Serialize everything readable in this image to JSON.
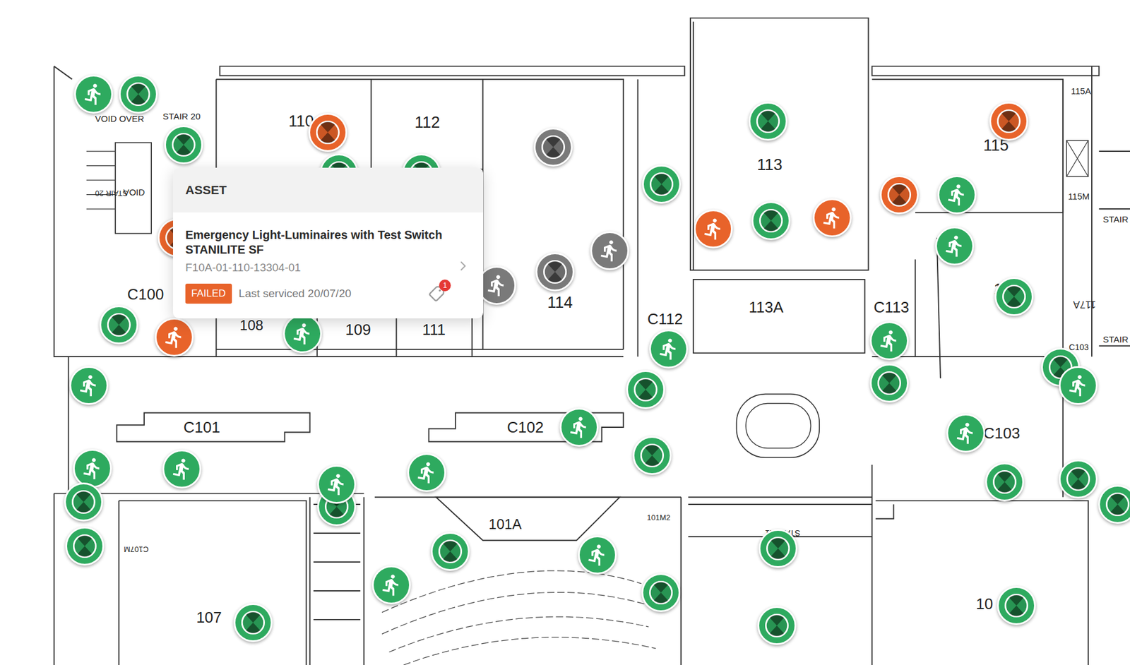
{
  "rooms": [
    {
      "label": "110"
    },
    {
      "label": "112"
    },
    {
      "label": "113"
    },
    {
      "label": "114"
    },
    {
      "label": "115"
    },
    {
      "label": "115A"
    },
    {
      "label": "115M"
    },
    {
      "label": "STAIR 20"
    },
    {
      "label": "VOID OVER"
    },
    {
      "label": "VOID"
    },
    {
      "label": "STAIR 20"
    },
    {
      "label": "C100"
    },
    {
      "label": "108"
    },
    {
      "label": "109"
    },
    {
      "label": "111"
    },
    {
      "label": "C112"
    },
    {
      "label": "113A"
    },
    {
      "label": "C113"
    },
    {
      "label": "11"
    },
    {
      "label": "117A"
    },
    {
      "label": "STAIR"
    },
    {
      "label": "C103"
    },
    {
      "label": "STAIR"
    },
    {
      "label": "C101"
    },
    {
      "label": "C102"
    },
    {
      "label": "C103"
    },
    {
      "label": "101A"
    },
    {
      "label": "101M2"
    },
    {
      "label": "STAIR 21"
    },
    {
      "label": "C107M"
    },
    {
      "label": "107"
    },
    {
      "label": "10"
    }
  ],
  "pins": [
    {
      "kind": "light",
      "status": "failed",
      "color": "#e8632a"
    },
    {
      "kind": "light",
      "status": "passed",
      "color": "#2eaa5f"
    },
    {
      "kind": "light",
      "status": "passed",
      "color": "#2eaa5f"
    },
    {
      "kind": "exit",
      "status": "passed",
      "color": "#2eaa5f"
    },
    {
      "kind": "light",
      "status": "passed",
      "color": "#2eaa5f"
    },
    {
      "kind": "light",
      "status": "passed",
      "color": "#2eaa5f"
    },
    {
      "kind": "light",
      "status": "failed",
      "color": "#e8632a"
    },
    {
      "kind": "light",
      "status": "unknown",
      "color": "#7a7a7a"
    },
    {
      "kind": "light",
      "status": "passed",
      "color": "#2eaa5f"
    },
    {
      "kind": "light",
      "status": "passed",
      "color": "#2eaa5f"
    },
    {
      "kind": "light",
      "status": "failed",
      "color": "#e8632a"
    },
    {
      "kind": "exit",
      "status": "failed",
      "color": "#e8632a"
    },
    {
      "kind": "light",
      "status": "passed",
      "color": "#2eaa5f"
    },
    {
      "kind": "exit",
      "status": "failed",
      "color": "#e8632a"
    },
    {
      "kind": "light",
      "status": "failed",
      "color": "#e8632a"
    },
    {
      "kind": "exit",
      "status": "passed",
      "color": "#2eaa5f"
    },
    {
      "kind": "exit",
      "status": "passed",
      "color": "#2eaa5f"
    },
    {
      "kind": "light",
      "status": "passed",
      "color": "#2eaa5f"
    },
    {
      "kind": "exit",
      "status": "unknown",
      "color": "#7a7a7a"
    },
    {
      "kind": "light",
      "status": "unknown",
      "color": "#7a7a7a"
    },
    {
      "kind": "exit",
      "status": "unknown",
      "color": "#7a7a7a"
    },
    {
      "kind": "light",
      "status": "passed",
      "color": "#2eaa5f"
    },
    {
      "kind": "exit",
      "status": "failed",
      "color": "#e8632a"
    },
    {
      "kind": "exit",
      "status": "passed",
      "color": "#2eaa5f"
    },
    {
      "kind": "exit",
      "status": "passed",
      "color": "#2eaa5f"
    },
    {
      "kind": "exit",
      "status": "passed",
      "color": "#2eaa5f"
    },
    {
      "kind": "light",
      "status": "passed",
      "color": "#2eaa5f"
    },
    {
      "kind": "light",
      "status": "passed",
      "color": "#2eaa5f"
    },
    {
      "kind": "exit",
      "status": "passed",
      "color": "#2eaa5f"
    },
    {
      "kind": "exit",
      "status": "passed",
      "color": "#2eaa5f"
    },
    {
      "kind": "light",
      "status": "passed",
      "color": "#2eaa5f"
    },
    {
      "kind": "exit",
      "status": "passed",
      "color": "#2eaa5f"
    },
    {
      "kind": "light",
      "status": "passed",
      "color": "#2eaa5f"
    },
    {
      "kind": "exit",
      "status": "passed",
      "color": "#2eaa5f"
    },
    {
      "kind": "light",
      "status": "passed",
      "color": "#2eaa5f"
    },
    {
      "kind": "light",
      "status": "passed",
      "color": "#2eaa5f"
    },
    {
      "kind": "exit",
      "status": "passed",
      "color": "#2eaa5f"
    },
    {
      "kind": "exit",
      "status": "passed",
      "color": "#2eaa5f"
    },
    {
      "kind": "light",
      "status": "passed",
      "color": "#2eaa5f"
    },
    {
      "kind": "exit",
      "status": "passed",
      "color": "#2eaa5f"
    },
    {
      "kind": "light",
      "status": "passed",
      "color": "#2eaa5f"
    },
    {
      "kind": "light",
      "status": "passed",
      "color": "#2eaa5f"
    },
    {
      "kind": "exit",
      "status": "passed",
      "color": "#2eaa5f"
    },
    {
      "kind": "light",
      "status": "passed",
      "color": "#2eaa5f"
    },
    {
      "kind": "exit",
      "status": "passed",
      "color": "#2eaa5f"
    },
    {
      "kind": "exit",
      "status": "passed",
      "color": "#2eaa5f"
    },
    {
      "kind": "light",
      "status": "passed",
      "color": "#2eaa5f"
    },
    {
      "kind": "light",
      "status": "passed",
      "color": "#2eaa5f"
    },
    {
      "kind": "light",
      "status": "passed",
      "color": "#2eaa5f"
    },
    {
      "kind": "light",
      "status": "passed",
      "color": "#2eaa5f"
    },
    {
      "kind": "light",
      "status": "passed",
      "color": "#2eaa5f"
    },
    {
      "kind": "light",
      "status": "passed",
      "color": "#2eaa5f"
    }
  ],
  "popup": {
    "header": "ASSET",
    "title": "Emergency Light-Luminaires with Test Switch STANILITE SF",
    "code": "F10A-01-110-13304-01",
    "status": "FAILED",
    "status_color": "#e8632a",
    "last_serviced": "Last serviced 20/07/20",
    "tag_count": "1"
  }
}
